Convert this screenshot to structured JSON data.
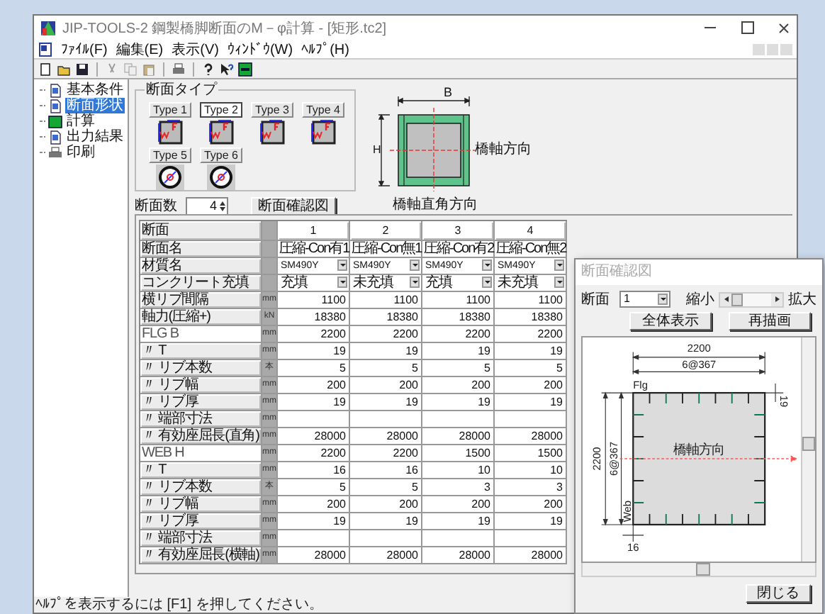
{
  "window": {
    "title": "JIP-TOOLS-2 鋼製橋脚断面のM－φ計算 - [矩形.tc2]"
  },
  "menu": [
    "ﾌｧｲﾙ(F)",
    "編集(E)",
    "表示(V)",
    "ｳｨﾝﾄﾞｳ(W)",
    "ﾍﾙﾌﾟ(H)"
  ],
  "tree": [
    {
      "label": "基本条件",
      "selected": false,
      "kind": "doc"
    },
    {
      "label": "断面形状",
      "selected": true,
      "kind": "doc"
    },
    {
      "label": "計算",
      "selected": false,
      "kind": "calc"
    },
    {
      "label": "出力結果",
      "selected": false,
      "kind": "doc"
    },
    {
      "label": "印刷",
      "selected": false,
      "kind": "printer"
    }
  ],
  "section_types": {
    "title": "断面タイプ",
    "types": [
      {
        "label": "Type 1",
        "selected": false,
        "kind": "rect"
      },
      {
        "label": "Type 2",
        "selected": true,
        "kind": "rect"
      },
      {
        "label": "Type 3",
        "selected": false,
        "kind": "rect"
      },
      {
        "label": "Type 4",
        "selected": false,
        "kind": "rect"
      },
      {
        "label": "Type 5",
        "selected": false,
        "kind": "circle"
      },
      {
        "label": "Type 6",
        "selected": false,
        "kind": "circle"
      }
    ]
  },
  "diagram": {
    "width_label": "B",
    "height_label": "H",
    "axis_label": "橋軸方向",
    "cross_axis_label": "橋軸直角方向"
  },
  "section_count": {
    "label": "断面数",
    "value": "4"
  },
  "confirm_button": "断面確認図",
  "table": {
    "header": "断面",
    "columns": [
      "1",
      "2",
      "3",
      "4"
    ],
    "rows": [
      {
        "label": "断面名",
        "unit": "",
        "kind": "text",
        "group_header": false,
        "cells": [
          "圧縮-Con有1",
          "圧縮-Con無1",
          "圧縮-Con有2",
          "圧縮-Con無2"
        ]
      },
      {
        "label": "材質名",
        "unit": "",
        "kind": "select",
        "group_header": false,
        "cells": [
          "SM490Y",
          "SM490Y",
          "SM490Y",
          "SM490Y"
        ]
      },
      {
        "label": "コンクリート充填",
        "unit": "",
        "kind": "select",
        "group_header": false,
        "cells": [
          "充填",
          "未充填",
          "充填",
          "未充填"
        ]
      },
      {
        "label": "横リブ間隔",
        "unit": "mm",
        "kind": "number",
        "group_header": false,
        "cells": [
          "1100",
          "1100",
          "1100",
          "1100"
        ]
      },
      {
        "label": "軸力(圧縮+)",
        "unit": "kN",
        "kind": "number",
        "group_header": false,
        "cells": [
          "18380",
          "18380",
          "18380",
          "18380"
        ]
      },
      {
        "label": "FLG B",
        "unit": "mm",
        "kind": "number",
        "group_header": true,
        "cells": [
          "2200",
          "2200",
          "2200",
          "2200"
        ]
      },
      {
        "label": "〃 T",
        "unit": "mm",
        "kind": "number",
        "group_header": false,
        "cells": [
          "19",
          "19",
          "19",
          "19"
        ]
      },
      {
        "label": "〃 リブ本数",
        "unit": "本",
        "kind": "number",
        "group_header": false,
        "cells": [
          "5",
          "5",
          "5",
          "5"
        ]
      },
      {
        "label": "〃 リブ幅",
        "unit": "mm",
        "kind": "number",
        "group_header": false,
        "cells": [
          "200",
          "200",
          "200",
          "200"
        ]
      },
      {
        "label": "〃 リブ厚",
        "unit": "mm",
        "kind": "number",
        "group_header": false,
        "cells": [
          "19",
          "19",
          "19",
          "19"
        ]
      },
      {
        "label": "〃 端部寸法",
        "unit": "mm",
        "kind": "number",
        "group_header": false,
        "cells": []
      },
      {
        "label": "〃 有効座屈長(直角)",
        "unit": "mm",
        "kind": "number",
        "group_header": false,
        "cells": [
          "28000",
          "28000",
          "28000",
          "28000"
        ]
      },
      {
        "label": "WEB H",
        "unit": "mm",
        "kind": "number",
        "group_header": true,
        "cells": [
          "2200",
          "2200",
          "1500",
          "1500"
        ]
      },
      {
        "label": "〃 T",
        "unit": "mm",
        "kind": "number",
        "group_header": false,
        "cells": [
          "16",
          "16",
          "10",
          "10"
        ]
      },
      {
        "label": "〃 リブ本数",
        "unit": "本",
        "kind": "number",
        "group_header": false,
        "cells": [
          "5",
          "5",
          "3",
          "3"
        ]
      },
      {
        "label": "〃 リブ幅",
        "unit": "mm",
        "kind": "number",
        "group_header": false,
        "cells": [
          "200",
          "200",
          "200",
          "200"
        ]
      },
      {
        "label": "〃 リブ厚",
        "unit": "mm",
        "kind": "number",
        "group_header": false,
        "cells": [
          "19",
          "19",
          "19",
          "19"
        ]
      },
      {
        "label": "〃 端部寸法",
        "unit": "mm",
        "kind": "number",
        "group_header": false,
        "cells": []
      },
      {
        "label": "〃 有効座屈長(横軸)",
        "unit": "mm",
        "kind": "number",
        "group_header": false,
        "cells": [
          "28000",
          "28000",
          "28000",
          "28000"
        ]
      }
    ]
  },
  "popup": {
    "title": "断面確認図",
    "section_label": "断面",
    "section_value": "1",
    "shrink_label": "縮小",
    "enlarge_label": "拡大",
    "buttons": [
      "全体表示",
      "再描画"
    ],
    "drawing": {
      "width_dim": "2200",
      "flange_pitch": "6@367",
      "flange_label": "Flg",
      "flange_thickness": "19",
      "height_dim": "2200",
      "web_pitch": "6@367",
      "web_label": "Web",
      "web_thickness": "16",
      "axis_label": "橋軸方向"
    },
    "close_button": "閉じる"
  },
  "status_bar": "ﾍﾙﾌﾟを表示するには [F1] を押してください。"
}
